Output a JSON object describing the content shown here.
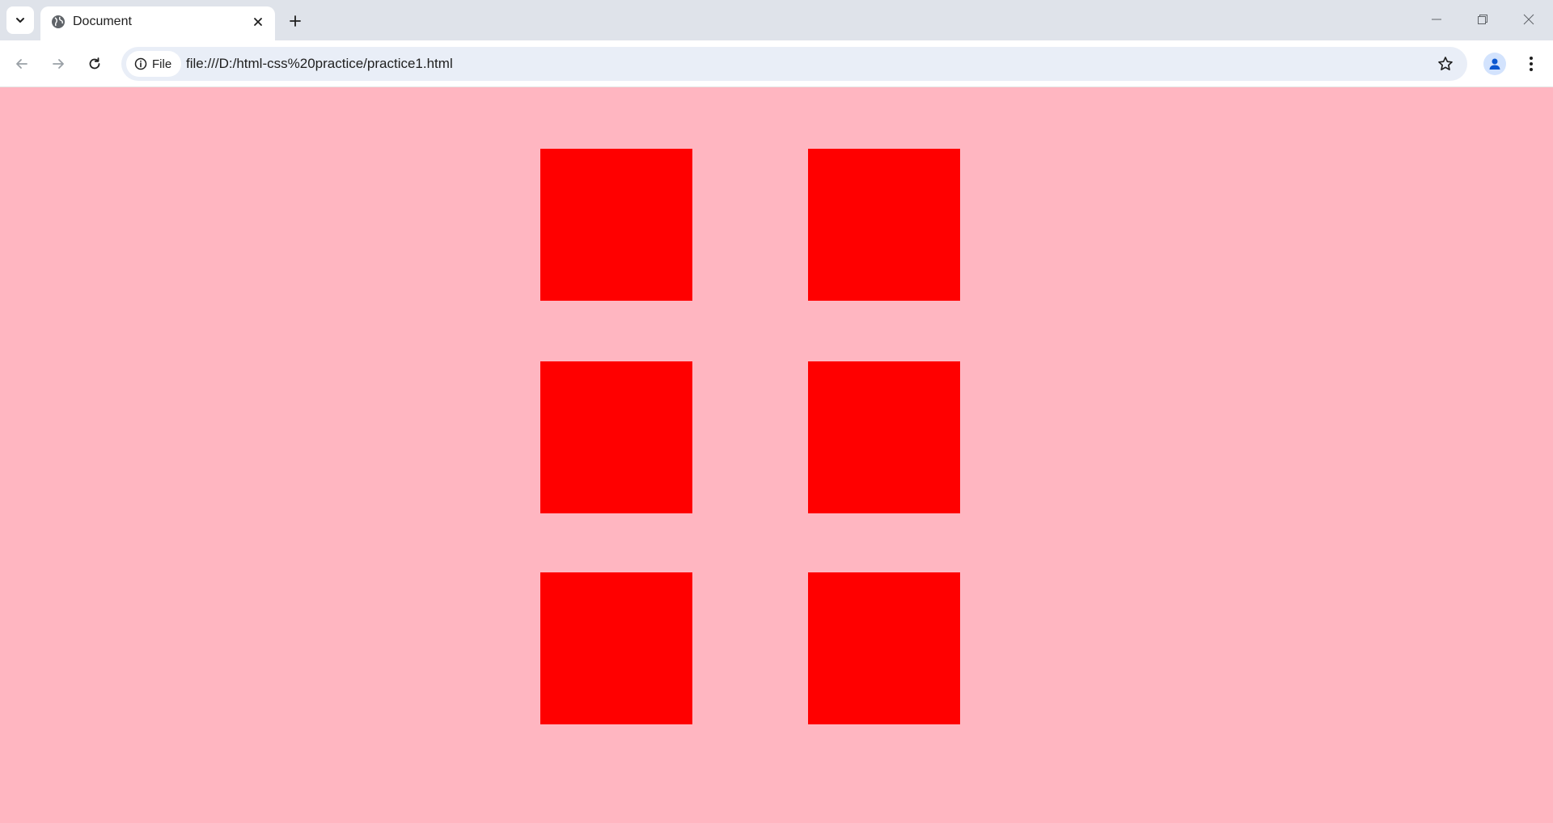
{
  "browser": {
    "tab": {
      "title": "Document",
      "favicon": "globe-icon"
    },
    "address_bar": {
      "site_chip_label": "File",
      "url": "file:///D:/html-css%20practice/practice1.html"
    },
    "icons": {
      "tab_search": "chevron-down-icon",
      "tab_close": "close-icon",
      "new_tab": "plus-icon",
      "back": "arrow-left-icon",
      "forward": "arrow-right-icon",
      "reload": "reload-icon",
      "site_info": "info-icon",
      "bookmark": "star-icon",
      "profile": "person-icon",
      "menu": "kebab-menu-icon"
    }
  },
  "page": {
    "background_color": "#ffb6c1",
    "box_color": "#ff0000",
    "boxes": [
      {
        "row": 1,
        "column": 1
      },
      {
        "row": 1,
        "column": 2
      },
      {
        "row": 2,
        "column": 1
      },
      {
        "row": 2,
        "column": 2
      },
      {
        "row": 3,
        "column": 1
      },
      {
        "row": 3,
        "column": 2
      }
    ]
  }
}
